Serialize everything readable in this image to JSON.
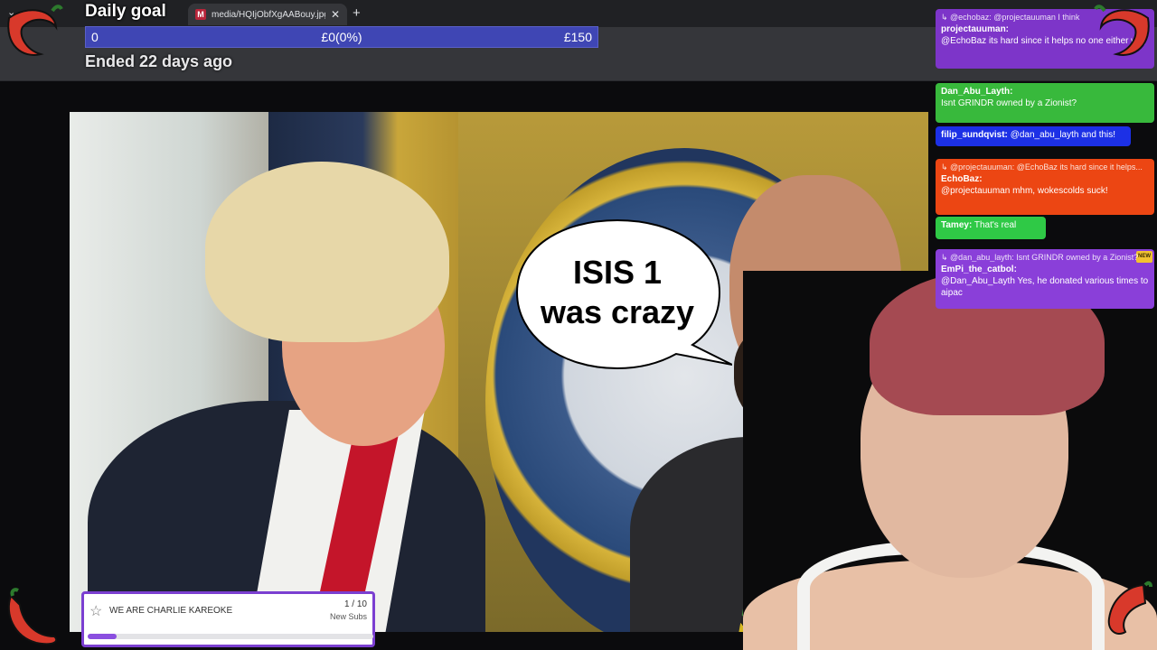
{
  "browser": {
    "tab_title": "media/HQIjObfXgAABouy.jpg (",
    "tab_close": "✕",
    "new_tab": "+",
    "tab_menu": "⌄"
  },
  "daily_goal": {
    "title": "Daily goal",
    "min": "0",
    "current": "£0(0%)",
    "max": "£150",
    "progress": 0,
    "status": "Ended 22 days ago"
  },
  "image_caption": {
    "line1": "ISIS 1",
    "line2": "was crazy"
  },
  "chat": {
    "messages": [
      {
        "reply": "↳ @echobaz: @projectauuman I think",
        "user": "projectauuman:",
        "body": "@EchoBaz its hard since it helps no one either way",
        "color": "#7d35c9"
      },
      {
        "reply": "",
        "user": "Dan_Abu_Layth:",
        "body": "Isnt GRINDR owned by a Zionist?",
        "color": "#38b93c"
      },
      {
        "reply": "",
        "user": "filip_sundqvist:",
        "body": "@dan_abu_layth and this!",
        "color": "#1c30e6"
      },
      {
        "reply": "↳ @projectauuman: @EchoBaz its hard since it helps...",
        "user": "EchoBaz:",
        "body": "@projectauuman mhm, wokescolds suck!",
        "color": "#ec4613"
      },
      {
        "reply": "",
        "user": "Tamey:",
        "body": "That's real",
        "color": "#2fc946"
      },
      {
        "reply": "↳ @dan_abu_layth: Isnt GRINDR owned by a Zionist?",
        "user": "EmPi_the_catbol:",
        "body": "@Dan_Abu_Layth Yes, he donated various times to aipac",
        "color": "#8a3fd9",
        "badge": "NEW"
      }
    ]
  },
  "subs_goal": {
    "name": "WE ARE CHARLIE KAREOKE",
    "count": "1 / 10",
    "label": "New Subs",
    "progress": 0.1
  },
  "colors": {
    "goal_bar": "#3f46b4",
    "subs_fill": "#8b4fe0",
    "chili": "#d8392b"
  }
}
